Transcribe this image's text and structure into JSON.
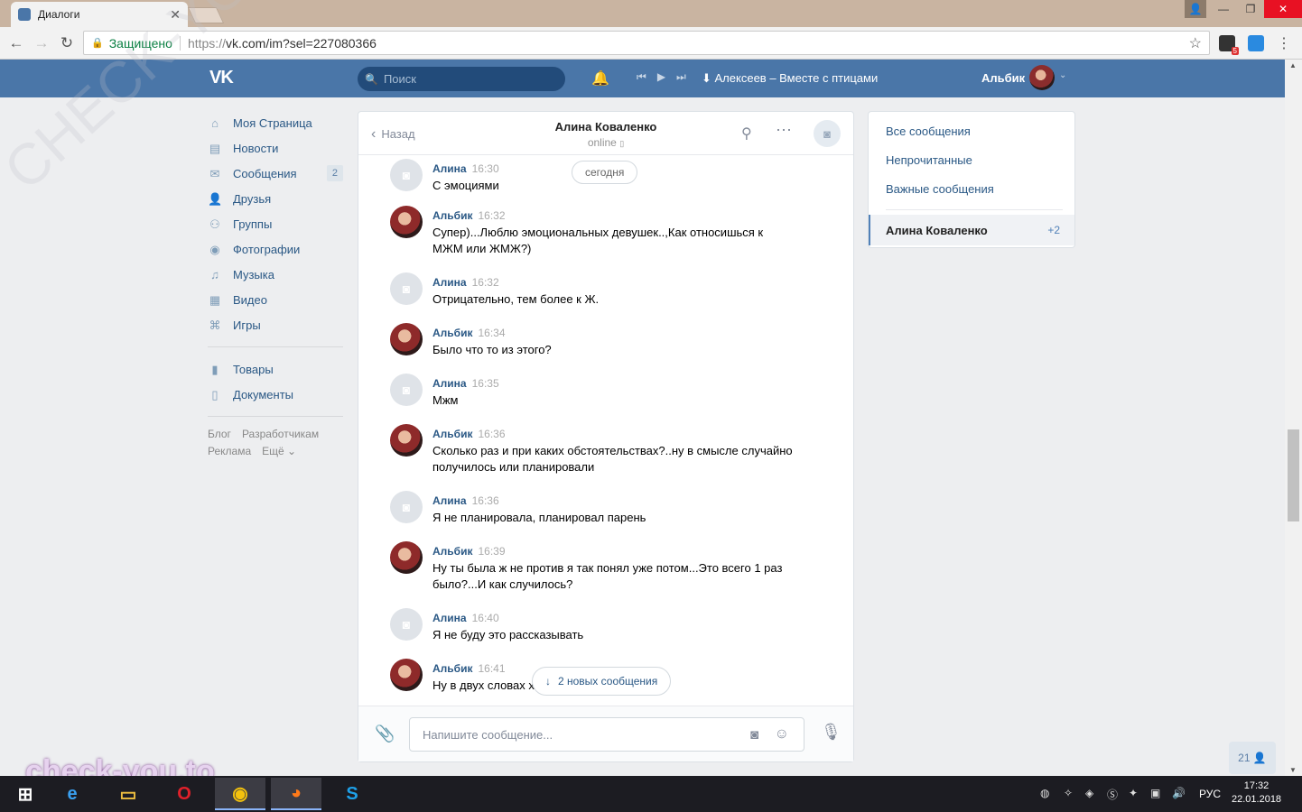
{
  "browser": {
    "tab_title": "Диалоги",
    "tab_close": "✕",
    "secure_label": "Защищено",
    "url_prefix": "https://",
    "url_main": "vk.com/im?sel=227080366",
    "ext_badge": "5"
  },
  "header": {
    "search_placeholder": "Поиск",
    "track": "Алексеев – Вместе с птицами",
    "user_name": "Альбик"
  },
  "nav": {
    "items": [
      {
        "label": "Моя Страница",
        "icon": "home-icon",
        "glyph": "⌂"
      },
      {
        "label": "Новости",
        "icon": "news-icon",
        "glyph": "▤"
      },
      {
        "label": "Сообщения",
        "icon": "messages-icon",
        "glyph": "✉",
        "badge": "2"
      },
      {
        "label": "Друзья",
        "icon": "friends-icon",
        "glyph": "👤"
      },
      {
        "label": "Группы",
        "icon": "groups-icon",
        "glyph": "⚇"
      },
      {
        "label": "Фотографии",
        "icon": "photos-icon",
        "glyph": "◉"
      },
      {
        "label": "Музыка",
        "icon": "music-icon",
        "glyph": "♫"
      },
      {
        "label": "Видео",
        "icon": "video-icon",
        "glyph": "▦"
      },
      {
        "label": "Игры",
        "icon": "games-icon",
        "glyph": "⌘"
      }
    ],
    "items2": [
      {
        "label": "Товары",
        "icon": "goods-icon",
        "glyph": "▮"
      },
      {
        "label": "Документы",
        "icon": "docs-icon",
        "glyph": "▯"
      }
    ],
    "footer": [
      "Блог",
      "Разработчикам",
      "Реклама",
      "Ещё ⌄"
    ]
  },
  "chat": {
    "back": "Назад",
    "name": "Алина Коваленко",
    "status": "online",
    "today": "сегодня",
    "new_messages": "2 новых сообщения",
    "input_placeholder": "Напишите сообщение...",
    "messages": [
      {
        "author": "Алина",
        "time": "16:30",
        "text": "С эмоциями",
        "avatar": "camera"
      },
      {
        "author": "Альбик",
        "time": "16:32",
        "text": "Супер)...Люблю эмоциональных девушек..,Как относишься к МЖМ или ЖМЖ?)",
        "avatar": "photo"
      },
      {
        "author": "Алина",
        "time": "16:32",
        "text": "Отрицательно, тем более к Ж.",
        "avatar": "camera"
      },
      {
        "author": "Альбик",
        "time": "16:34",
        "text": "Было что то из этого?",
        "avatar": "photo"
      },
      {
        "author": "Алина",
        "time": "16:35",
        "text": "Мжм",
        "avatar": "camera"
      },
      {
        "author": "Альбик",
        "time": "16:36",
        "text": "Сколько раз и при каких обстоятельствах?..ну в смысле случайно получилось или планировали",
        "avatar": "photo"
      },
      {
        "author": "Алина",
        "time": "16:36",
        "text": "Я не планировала, планировал парень",
        "avatar": "camera"
      },
      {
        "author": "Альбик",
        "time": "16:39",
        "text": "Ну ты была ж не против я так понял уже потом...Это всего 1 раз было?...И как случилось?",
        "avatar": "photo"
      },
      {
        "author": "Алина",
        "time": "16:40",
        "text": "Я не буду это рассказывать",
        "avatar": "camera"
      },
      {
        "author": "Альбик",
        "time": "16:41",
        "text": "Ну в двух словах х",
        "avatar": "photo"
      }
    ]
  },
  "right": {
    "filters": [
      "Все сообщения",
      "Непрочитанные",
      "Важные сообщения"
    ],
    "selected_conv": "Алина Коваленко",
    "selected_count": "+2"
  },
  "online_count": "21",
  "taskbar": {
    "lang": "РУС",
    "time": "17:32",
    "date": "22.01.2018"
  },
  "watermark": {
    "bottom": "check-you.to",
    "diagonal": "CHECK-YOU.ME"
  },
  "colors": {
    "vk_blue": "#4a76a8",
    "link": "#2a5885"
  }
}
